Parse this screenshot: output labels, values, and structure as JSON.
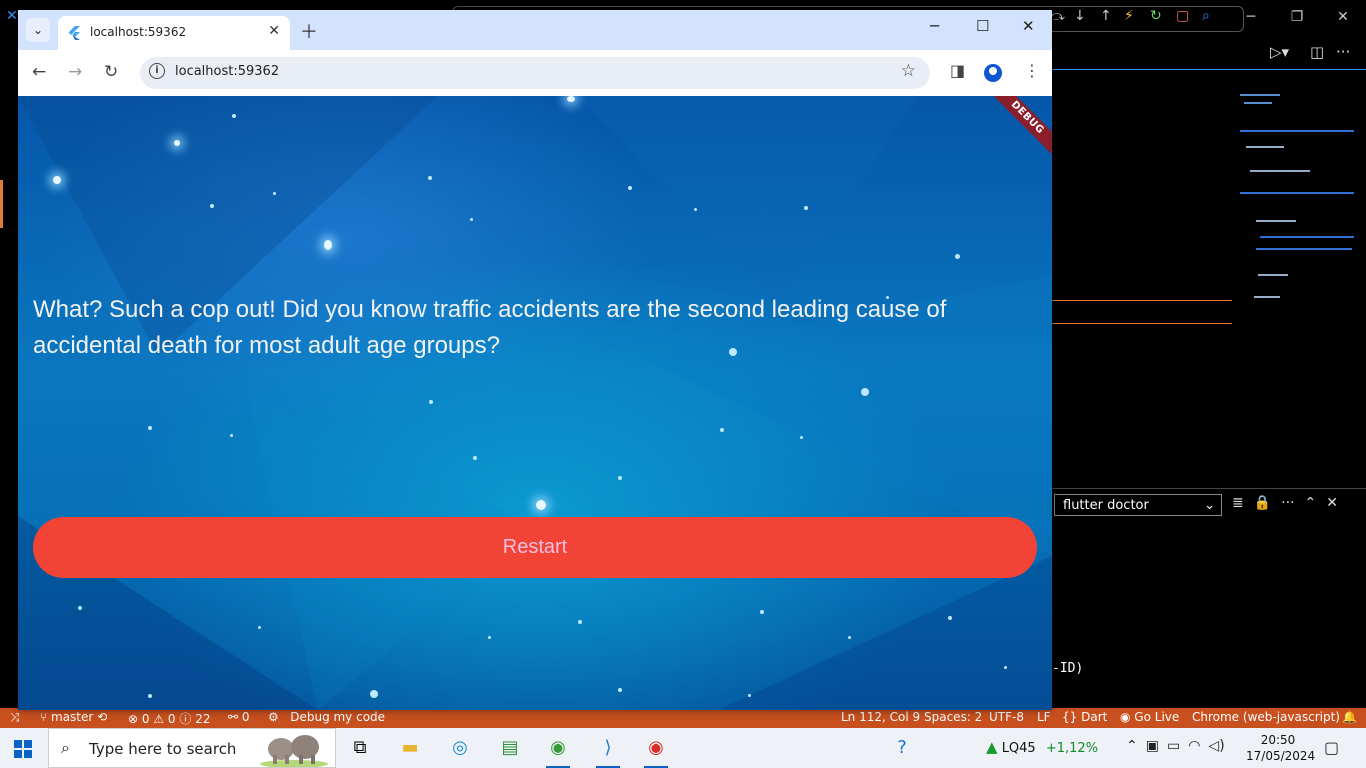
{
  "chrome": {
    "tab_title": "localhost:59362",
    "url": "localhost:59362",
    "icons": {
      "tab_search": "chevron-down-icon",
      "close_tab": "close-icon",
      "new_tab": "plus-icon",
      "back": "back-arrow-icon",
      "forward": "forward-arrow-icon",
      "reload": "reload-icon",
      "site_info": "info-icon",
      "bookmark": "star-icon",
      "side_panel": "side-panel-icon",
      "profile": "profile-icon",
      "menu": "kebab-menu-icon"
    }
  },
  "app": {
    "debug_banner": "DEBUG",
    "question": "What? Such a cop out! Did you know traffic accidents are the second leading cause of accidental death for most adult age groups?",
    "restart_label": "Restart",
    "colors": {
      "button": "#f24436",
      "button_text": "#f8bfe0",
      "background": "#0a77bf"
    }
  },
  "vscode": {
    "terminal_select": "flutter doctor",
    "terminal_fragment": "-ID)",
    "status": {
      "branch": "master",
      "errors": "0",
      "warnings": "0",
      "infos": "22",
      "ports": "0",
      "debug": "Debug my code",
      "position": "Ln 112, Col 9",
      "spaces": "Spaces: 2",
      "encoding": "UTF-8",
      "eol": "LF",
      "language": "Dart",
      "golive": "Go Live",
      "device": "Chrome (web-javascript)"
    }
  },
  "taskbar": {
    "search_placeholder": "Type here to search",
    "stock_name": "LQ45",
    "stock_change": "+1,12%",
    "time": "20:50",
    "date": "17/05/2024"
  }
}
